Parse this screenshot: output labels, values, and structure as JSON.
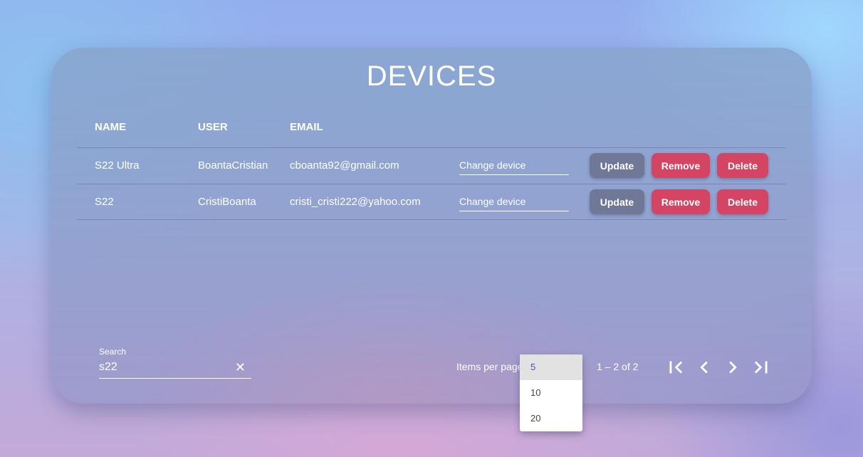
{
  "page": {
    "title": "DEVICES"
  },
  "table": {
    "headers": [
      "NAME",
      "USER",
      "EMAIL"
    ],
    "rows": [
      {
        "name": "S22 Ultra",
        "user": "BoantaCristian",
        "email": "cboanta92@gmail.com",
        "change_placeholder": "Change device"
      },
      {
        "name": "S22",
        "user": "CristiBoanta",
        "email": "cristi_cristi222@yahoo.com",
        "change_placeholder": "Change device"
      }
    ],
    "actions": {
      "update": "Update",
      "remove": "Remove",
      "delete": "Delete"
    }
  },
  "search": {
    "label": "Search",
    "value": "s22",
    "clear_icon": "close-icon"
  },
  "paginator": {
    "items_per_page_label": "Items per page",
    "range_label": "1 – 2 of 2",
    "options": [
      "5",
      "10",
      "20"
    ],
    "selected": "5",
    "icons": [
      "first-page-icon",
      "previous-page-icon",
      "next-page-icon",
      "last-page-icon"
    ]
  },
  "colors": {
    "danger": "#d44563",
    "neutral": "#6f7897",
    "accent": "#3f51b5"
  }
}
